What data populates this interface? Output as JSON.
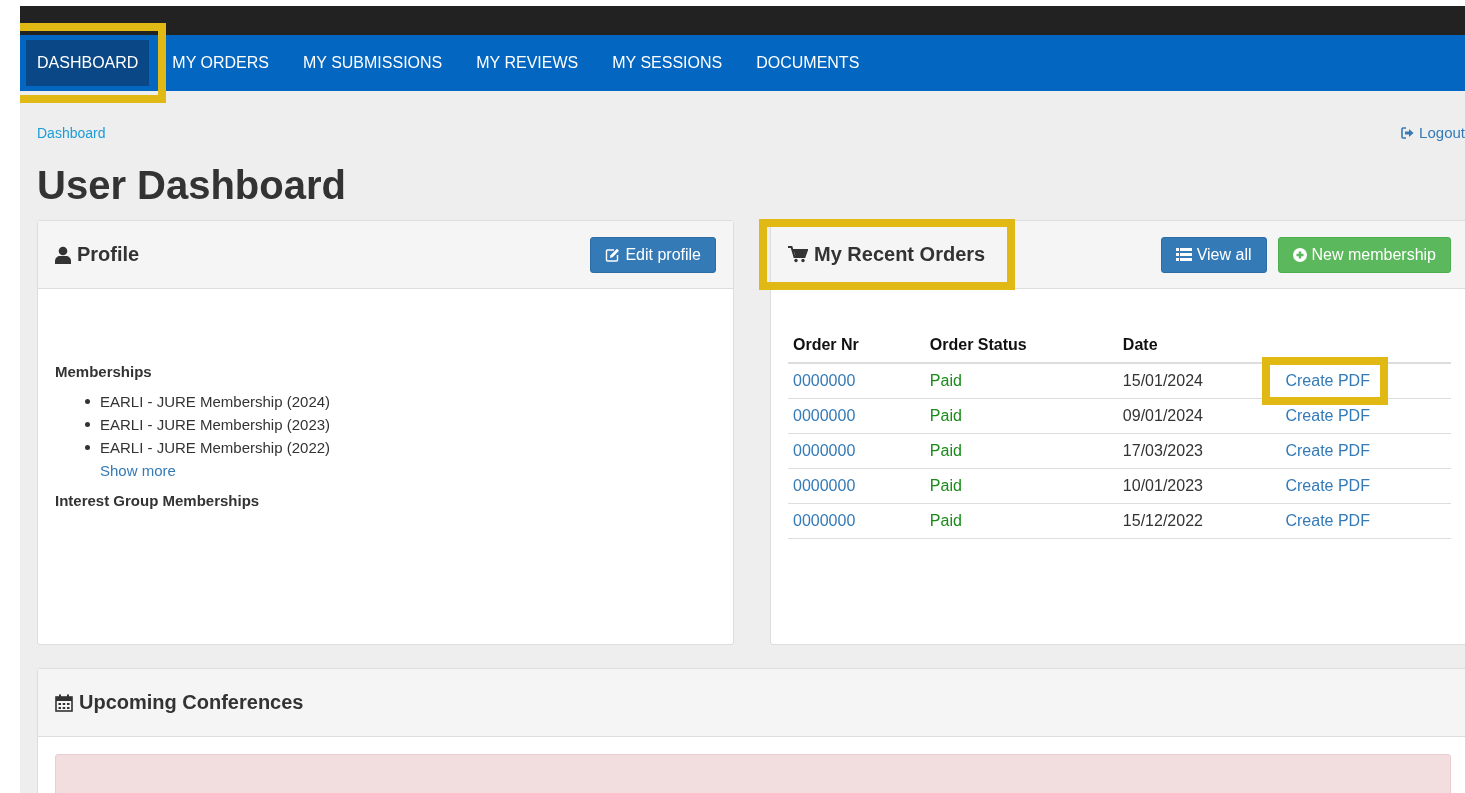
{
  "nav": {
    "tabs": [
      {
        "label": "DASHBOARD",
        "selected": true,
        "highlighted": true
      },
      {
        "label": "MY ORDERS",
        "selected": false,
        "highlighted": false
      },
      {
        "label": "MY SUBMISSIONS",
        "selected": false,
        "highlighted": false
      },
      {
        "label": "MY REVIEWS",
        "selected": false,
        "highlighted": false
      },
      {
        "label": "MY SESSIONS",
        "selected": false,
        "highlighted": false
      },
      {
        "label": "DOCUMENTS",
        "selected": false,
        "highlighted": false
      }
    ]
  },
  "breadcrumb": "Dashboard",
  "logout": "Logout",
  "page_title": "User Dashboard",
  "profile": {
    "title": "Profile",
    "edit_button": "Edit profile",
    "memberships_heading": "Memberships",
    "memberships": [
      "EARLI - JURE Membership (2024)",
      "EARLI - JURE Membership (2023)",
      "EARLI - JURE Membership (2022)"
    ],
    "show_more": "Show more",
    "interest_heading": "Interest Group Memberships"
  },
  "orders": {
    "title": "My Recent Orders",
    "title_highlighted": true,
    "view_all": "View all",
    "new_membership": "New membership",
    "columns": [
      "Order Nr",
      "Order Status",
      "Date"
    ],
    "rows": [
      {
        "order_nr": "0000000",
        "status": "Paid",
        "date": "15/01/2024",
        "action": "Create PDF",
        "highlighted": true
      },
      {
        "order_nr": "0000000",
        "status": "Paid",
        "date": "09/01/2024",
        "action": "Create PDF",
        "highlighted": false
      },
      {
        "order_nr": "0000000",
        "status": "Paid",
        "date": "17/03/2023",
        "action": "Create PDF",
        "highlighted": false
      },
      {
        "order_nr": "0000000",
        "status": "Paid",
        "date": "10/01/2023",
        "action": "Create PDF",
        "highlighted": false
      },
      {
        "order_nr": "0000000",
        "status": "Paid",
        "date": "15/12/2022",
        "action": "Create PDF",
        "highlighted": false
      }
    ]
  },
  "conferences": {
    "title": "Upcoming Conferences"
  }
}
